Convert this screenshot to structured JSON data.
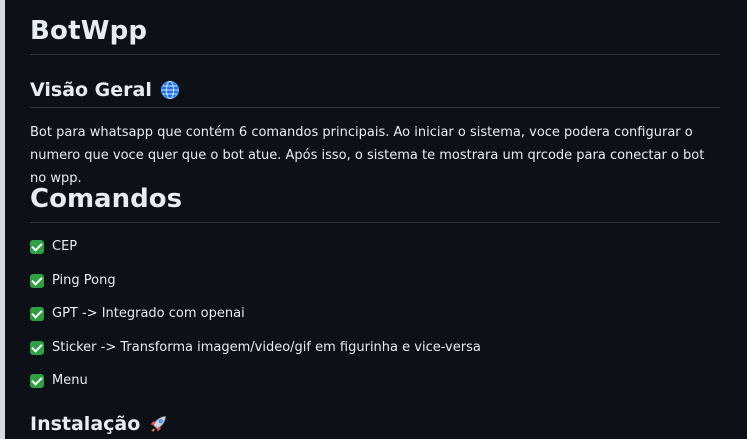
{
  "document": {
    "title": "BotWpp",
    "overview": {
      "heading": "Visão Geral",
      "heading_icon": "globe-icon",
      "description": "Bot para whatsapp que contém 6 comandos principais. Ao iniciar o sistema, voce podera configurar o numero que voce quer que o bot atue. Após isso, o sistema te mostrara um qrcode para conectar o bot no wpp."
    },
    "commands": {
      "heading": "Comandos",
      "items": [
        {
          "label": "CEP",
          "icon": "check-icon"
        },
        {
          "label": "Ping Pong",
          "icon": "check-icon"
        },
        {
          "label": "GPT -> Integrado com openai",
          "icon": "check-icon"
        },
        {
          "label": "Sticker -> Transforma imagem/video/gif em figurinha e vice-versa",
          "icon": "check-icon"
        },
        {
          "label": "Menu",
          "icon": "check-icon"
        }
      ]
    },
    "installation": {
      "heading": "Instalação",
      "heading_icon": "rocket-icon"
    }
  },
  "colors": {
    "background": "#0d1117",
    "text": "#e6edf3",
    "divider": "#30363d",
    "check": "#2ea043"
  }
}
